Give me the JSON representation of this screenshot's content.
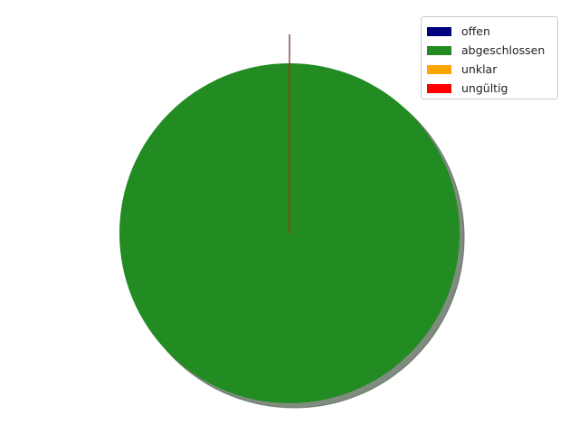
{
  "chart_data": {
    "type": "pie",
    "title": "",
    "categories": [
      "offen",
      "abgeschlossen",
      "unklar",
      "ungültig"
    ],
    "values": [
      0,
      100,
      0,
      0
    ],
    "colors": [
      "#000080",
      "#228b22",
      "#ffa500",
      "#ff0000"
    ],
    "shadow": true,
    "start_angle_deg": 90,
    "legend": {
      "placement": "top-right",
      "items": [
        {
          "label": "offen",
          "color": "#000080"
        },
        {
          "label": "abgeschlossen",
          "color": "#228b22"
        },
        {
          "label": "unklar",
          "color": "#ffa500"
        },
        {
          "label": "ungültig",
          "color": "#ff0000"
        }
      ]
    }
  }
}
